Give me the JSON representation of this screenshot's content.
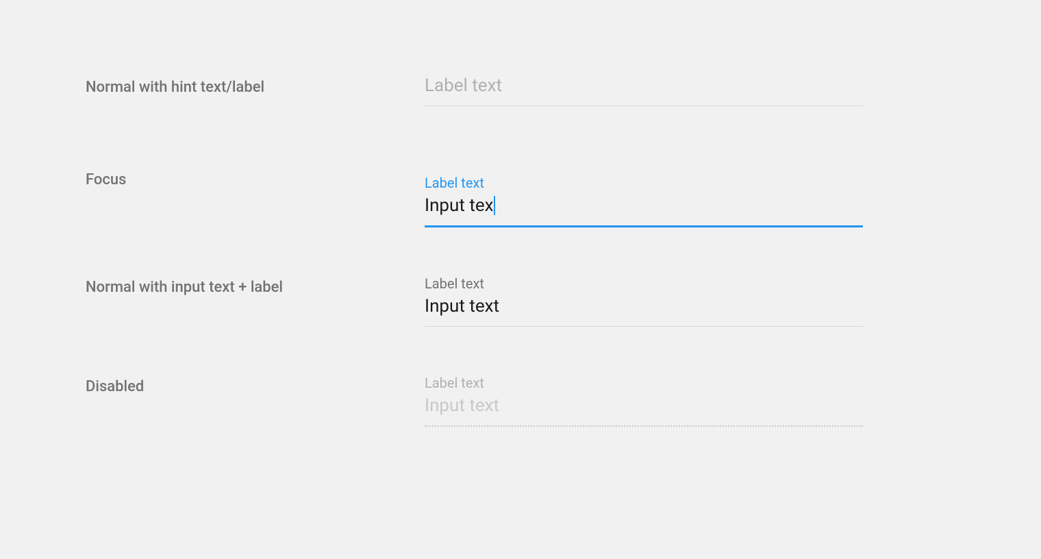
{
  "rows": [
    {
      "state_label": "Normal with hint text/label",
      "hint": "Label text"
    },
    {
      "state_label": "Focus",
      "label": "Label text",
      "value": "Input tex"
    },
    {
      "state_label": "Normal with input text + label",
      "label": "Label text",
      "value": "Input text"
    },
    {
      "state_label": "Disabled",
      "label": "Label text",
      "value": "Input text"
    }
  ],
  "colors": {
    "accent": "#2196f3",
    "text_primary": "#1a1a1a",
    "text_secondary": "#727272",
    "text_hint": "#b0b0b0",
    "text_disabled": "#c9c9c9"
  }
}
